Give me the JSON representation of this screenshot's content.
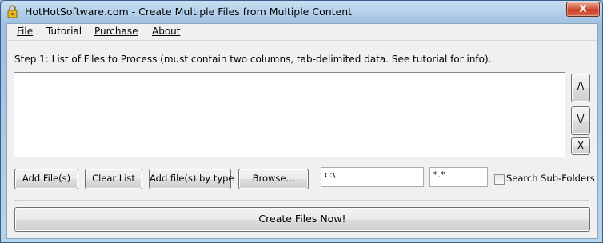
{
  "window": {
    "title": "HotHotSoftware.com - Create Multiple Files from Multiple Content",
    "close_glyph": "X",
    "icon": "app-lock-icon"
  },
  "menu": {
    "items": [
      {
        "label": "File"
      },
      {
        "label": "Tutorial"
      },
      {
        "label": "Purchase"
      },
      {
        "label": "About"
      }
    ]
  },
  "step1": {
    "label": "Step 1: List of Files to Process (must contain two columns, tab-delimited data. See tutorial for info).",
    "move_up": "/\\",
    "move_down": "\\/",
    "remove": "X"
  },
  "controls": {
    "add_files": "Add File(s)",
    "clear_list": "Clear List",
    "add_by_type": "Add file(s) by type",
    "browse": "Browse...",
    "path_value": "c:\\",
    "filter_value": "*.*",
    "search_subfolders": "Search Sub-Folders"
  },
  "create_button": "Create Files Now!",
  "colors": {
    "title_gradient_top": "#c9dff2",
    "client_bg": "#f0f0f0",
    "close_red": "#c43c24"
  }
}
